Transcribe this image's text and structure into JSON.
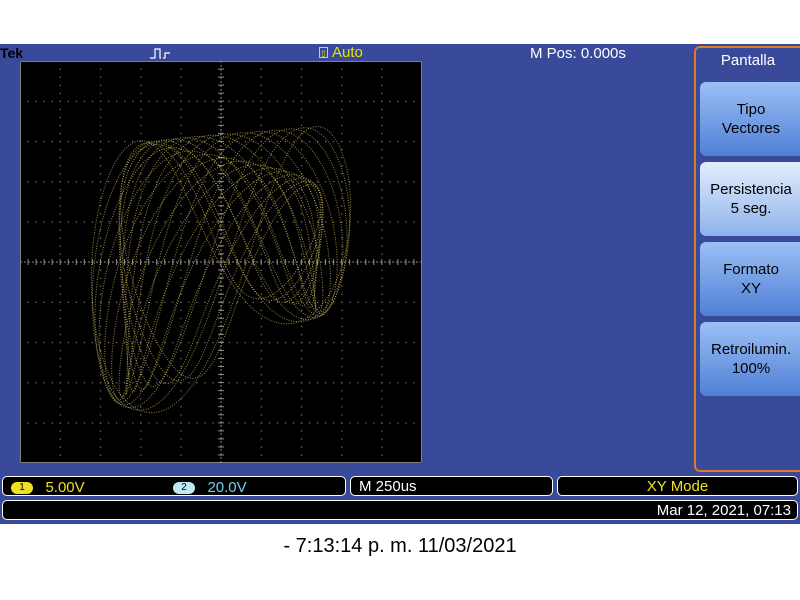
{
  "topbar": {
    "brand": "Tek",
    "acquisition_mode": "Auto",
    "horizontal_position": "M Pos: 0.000s"
  },
  "menu": {
    "title": "Pantalla",
    "buttons": [
      {
        "line1": "Tipo",
        "line2": "Vectores",
        "selected": false
      },
      {
        "line1": "Persistencia",
        "line2": "5 seg.",
        "selected": true
      },
      {
        "line1": "Formato",
        "line2": "XY",
        "selected": false
      },
      {
        "line1": "Retroilumin.",
        "line2": "100%",
        "selected": false
      }
    ]
  },
  "status": {
    "ch1": {
      "number": "1",
      "scale": "5.00V",
      "color": "#f0e020"
    },
    "ch2": {
      "number": "2",
      "scale": "20.0V",
      "color": "#6cd4ec"
    },
    "timebase": "M 250us",
    "mode": "XY Mode",
    "datetime": "Mar 12, 2021, 07:13"
  },
  "caption": "- 7:13:14 p. m.   11/03/2021",
  "colors": {
    "background": "#3a4a9a",
    "trace": "#c8b45a",
    "menu_border": "#e07a20"
  },
  "icons": [
    "trigger-pulse-icon",
    "acquisition-icon"
  ]
}
